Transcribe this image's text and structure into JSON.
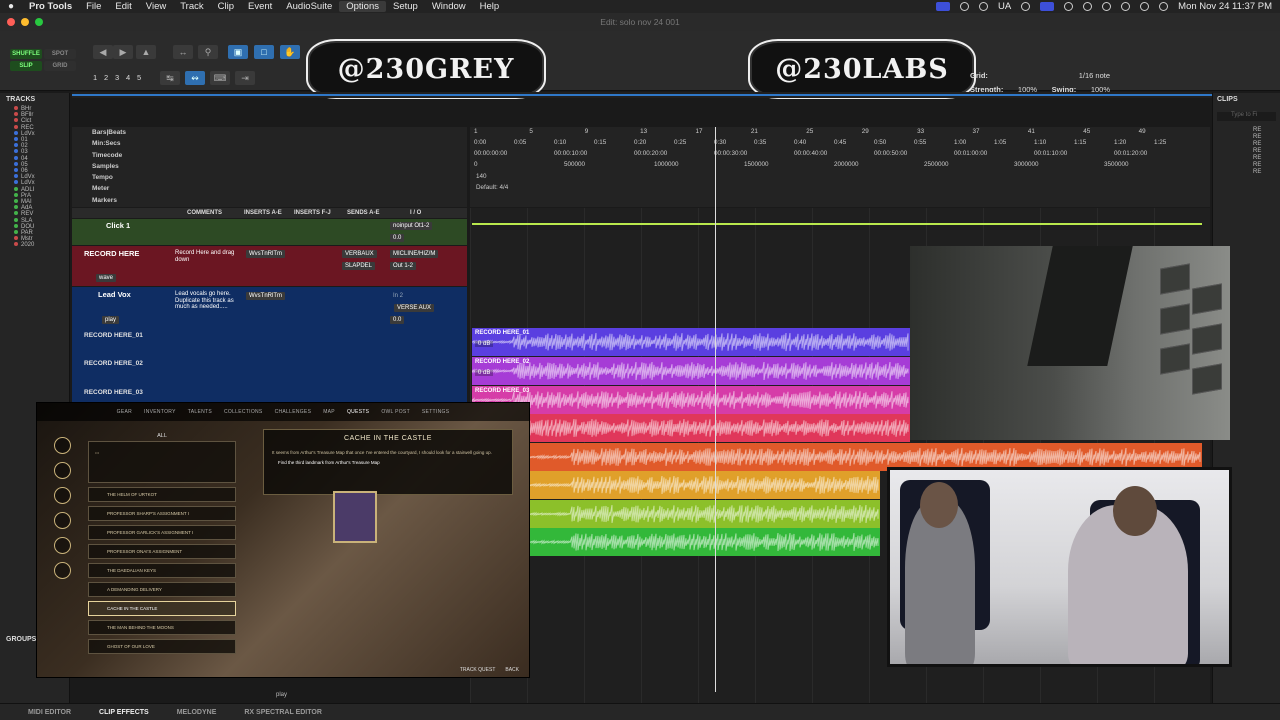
{
  "menubar": {
    "app": "Pro Tools",
    "items": [
      "File",
      "Edit",
      "View",
      "Track",
      "Clip",
      "Event",
      "AudioSuite",
      "Options",
      "Setup",
      "Window",
      "Help"
    ],
    "active_item": "Options",
    "input_source": "UA",
    "clock": "Mon Nov 24  11:37 PM"
  },
  "window": {
    "title": "Edit: solo nov 24 001"
  },
  "toolbar": {
    "modes": [
      "SHUFFLE",
      "SPOT",
      "SLIP",
      "GRID"
    ],
    "zoom_presets": [
      "1",
      "2",
      "3",
      "4",
      "5"
    ],
    "banner_left": "@230GREY",
    "banner_right": "@230LABS",
    "grid_label": "Grid:",
    "grid_value": "1/16 note",
    "strength_label": "Strength:",
    "strength_value": "100%",
    "swing_label": "Swing:",
    "swing_value": "100%"
  },
  "tracks_panel": {
    "title": "TRACKS",
    "items": [
      {
        "name": "BHr",
        "color": "#c94a4a"
      },
      {
        "name": "BFllr",
        "color": "#c94a4a"
      },
      {
        "name": "Clct",
        "color": "#c94a4a"
      },
      {
        "name": "REC",
        "color": "#c94a4a"
      },
      {
        "name": "LdVx",
        "color": "#3b6fd9"
      },
      {
        "name": "01",
        "color": "#3b6fd9"
      },
      {
        "name": "02",
        "color": "#3b6fd9"
      },
      {
        "name": "03",
        "color": "#3b6fd9"
      },
      {
        "name": "04",
        "color": "#3b6fd9"
      },
      {
        "name": "05",
        "color": "#3b6fd9"
      },
      {
        "name": "06",
        "color": "#3b6fd9"
      },
      {
        "name": "LdVx",
        "color": "#3b6fd9"
      },
      {
        "name": "LdVx",
        "color": "#3b6fd9"
      },
      {
        "name": "ADLI",
        "color": "#43b24a"
      },
      {
        "name": "PrA",
        "color": "#43b24a"
      },
      {
        "name": "MAI",
        "color": "#43b24a"
      },
      {
        "name": "AdA",
        "color": "#43b24a"
      },
      {
        "name": "REV",
        "color": "#43b24a"
      },
      {
        "name": "SLA",
        "color": "#43b24a"
      },
      {
        "name": "DOU",
        "color": "#43b24a"
      },
      {
        "name": "PAR",
        "color": "#43b24a"
      },
      {
        "name": "Mstr",
        "color": "#c94a4a"
      },
      {
        "name": "2020",
        "color": "#c94a4a"
      }
    ],
    "groups_title": "GROUPS"
  },
  "rulers": {
    "labels": [
      "Bars|Beats",
      "Min:Secs",
      "Timecode",
      "Samples",
      "Tempo",
      "Meter",
      "Markers"
    ],
    "bars": [
      "1",
      "5",
      "9",
      "13",
      "17",
      "21",
      "25",
      "29",
      "33",
      "37",
      "41",
      "45",
      "49"
    ],
    "minsecs": [
      "0:00",
      "0:05",
      "0:10",
      "0:15",
      "0:20",
      "0:25",
      "0:30",
      "0:35",
      "0:40",
      "0:45",
      "0:50",
      "0:55",
      "1:00",
      "1:05",
      "1:10",
      "1:15",
      "1:20",
      "1:25"
    ],
    "timecode": [
      "00:00:00:00",
      "00:00:10:00",
      "00:00:20:00",
      "00:00:30:00",
      "00:00:40:00",
      "00:00:50:00",
      "00:01:00:00",
      "00:01:10:00",
      "00:01:20:00"
    ],
    "samples": [
      "0",
      "500000",
      "1000000",
      "1500000",
      "2000000",
      "2500000",
      "3000000",
      "3500000"
    ],
    "tempo": "140",
    "meter": "Default: 4/4"
  },
  "mix_header": [
    "COMMENTS",
    "INSERTS A-E",
    "INSERTS F-J",
    "SENDS A-E",
    "I / O"
  ],
  "tracks": [
    {
      "name": "Click 1",
      "comment": "",
      "insert": "",
      "io": "noinput  Ot1-2",
      "vol": "0.0",
      "color": "#2d8a2d"
    },
    {
      "name": "RECORD HERE",
      "comment": "Record Here and drag down",
      "insert": "WvsTnRlTm",
      "sends": [
        "VERBAUX",
        "SLAPDEL"
      ],
      "io": "MICLINE/HIZ/M",
      "io2": "Out 1-2",
      "vol": "0.0",
      "mode": "wave",
      "color": "#8d1d2a"
    },
    {
      "name": "Lead Vox",
      "comment": "Lead vocals go here. Duplicate this track as much as needed.....",
      "insert": "WvsTnRlTm",
      "io": "In 2",
      "send": "VERSE AUX",
      "vol": "0.0",
      "mode": "play",
      "color": "#173c86"
    }
  ],
  "subtracks": [
    "RECORD HERE_01",
    "RECORD HERE_02",
    "RECORD HERE_03"
  ],
  "clips": [
    {
      "label": "RECORD HERE_01",
      "db": "0 dB",
      "color": "#5a3fe0"
    },
    {
      "label": "RECORD HERE_02",
      "db": "0 dB",
      "color": "#a63cd6"
    },
    {
      "label": "RECORD HERE_03",
      "db": "",
      "color": "#d63ca8"
    },
    {
      "label": "4",
      "db": "",
      "color": "#e0375a"
    },
    {
      "label": "",
      "db": "",
      "color": "#e05a2a"
    },
    {
      "label": "",
      "db": "",
      "color": "#e0a02a"
    },
    {
      "label": "",
      "db": "",
      "color": "#8cc02a"
    },
    {
      "label": "",
      "db": "",
      "color": "#33b83a"
    }
  ],
  "clips_panel": {
    "title": "CLIPS",
    "search_placeholder": "Type to Fi",
    "items": [
      "RE",
      "RE",
      "RE",
      "RE",
      "RE",
      "RE",
      "RE"
    ]
  },
  "game": {
    "tabs": [
      "GEAR",
      "INVENTORY",
      "TALENTS",
      "COLLECTIONS",
      "CHALLENGES",
      "MAP",
      "QUESTS",
      "OWL POST",
      "SETTINGS"
    ],
    "active_tab": "QUESTS",
    "list_header": "ALL",
    "quests": [
      "THE HELM OF URTKOT",
      "PROFESSOR SHARP'S ASSIGNMENT I",
      "PROFESSOR GARLICK'S ASSIGNMENT I",
      "PROFESSOR ONAI'S ASSIGNMENT",
      "THE DAEDALIAN KEYS",
      "A DEMANDING DELIVERY",
      "CACHE IN THE CASTLE",
      "THE MAN BEHIND THE MOONS",
      "GHOST OF OUR LOVE"
    ],
    "selected_quest": "CACHE IN THE CASTLE",
    "detail_title": "CACHE IN THE CASTLE",
    "detail_text": "It seems from Arthur's Treasure Map that once I've entered the courtyard, I should look for a stairwell going up.",
    "objective": "Find the third landmark from Arthur's Treasure Map",
    "footer": [
      "TRACK QUEST",
      "BACK"
    ]
  },
  "timeline_play_label": "play",
  "bottombar": {
    "items": [
      "MIDI EDITOR",
      "CLIP EFFECTS",
      "MELODYNE",
      "RX SPECTRAL EDITOR"
    ],
    "active": "CLIP EFFECTS"
  }
}
